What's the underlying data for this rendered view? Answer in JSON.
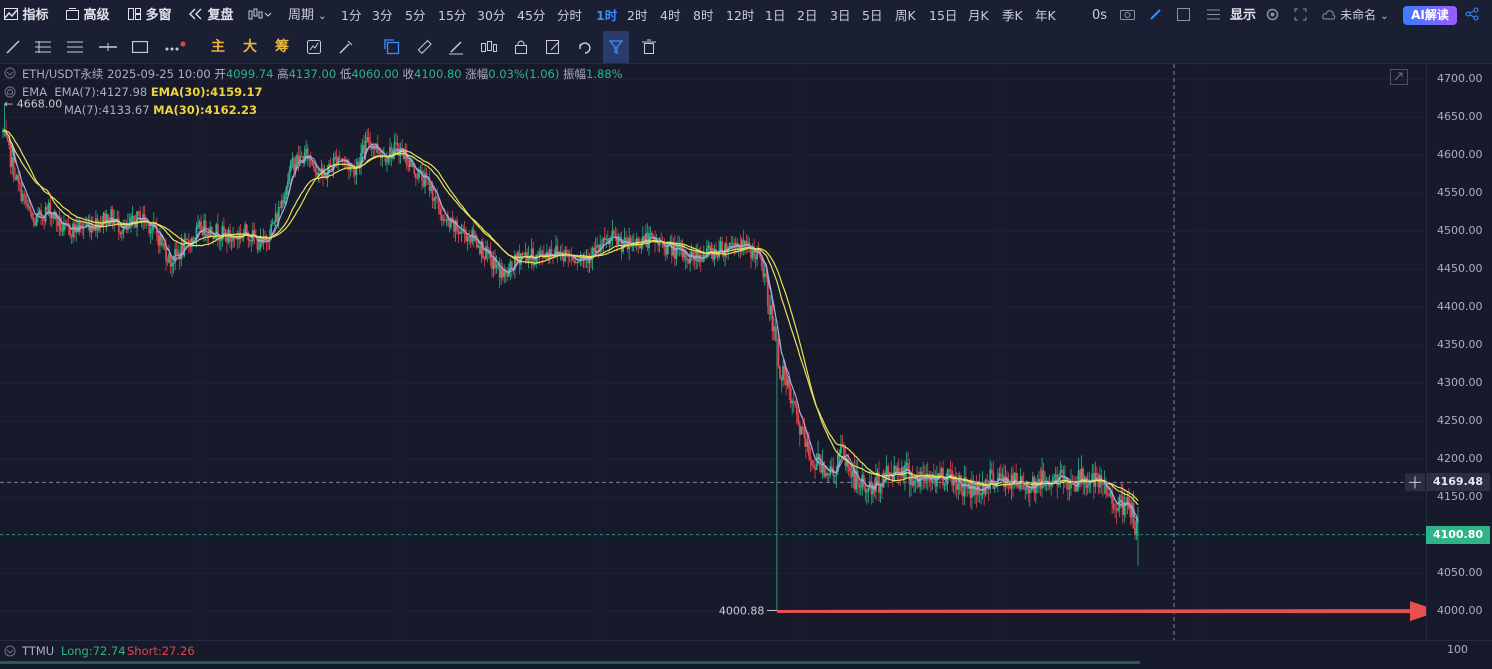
{
  "toolbar": {
    "indicators": "指标",
    "template": "高级",
    "multi_window": "多窗",
    "replay": "复盘",
    "period": "周期",
    "timeframes": [
      "1分",
      "3分",
      "5分",
      "15分",
      "30分",
      "45分",
      "分时",
      "1时",
      "2时",
      "4时",
      "8时",
      "12时",
      "1日",
      "2日",
      "3日",
      "5日",
      "周K",
      "15日",
      "月K",
      "季K",
      "年K"
    ],
    "active_timeframe": "1时",
    "latency": "0s",
    "display": "显示",
    "layout_name": "未命名",
    "ai_label": "AI解读"
  },
  "drawing_tools": {
    "main_label": "主",
    "big_label": "大",
    "chip_label": "筹"
  },
  "legend": {
    "symbol": "ETH/USDT永续",
    "datetime": "2025-09-25 10:00",
    "open_label": "开",
    "open": "4099.74",
    "high_label": "高",
    "high": "4137.00",
    "low_label": "低",
    "low": "4060.00",
    "close_label": "收",
    "close": "4100.80",
    "change_label": "涨幅",
    "change": "0.03%(1.06)",
    "amp_label": "振幅",
    "amp": "1.88%",
    "ema_name": "EMA",
    "ema7": "EMA(7):4127.98",
    "ema30": "EMA(30):4159.17",
    "ma7": "MA(7):4133.67",
    "ma30": "MA(30):4162.23"
  },
  "markers": {
    "high_mark": "4668.00",
    "low_mark": "4000.88",
    "crosshair_price": "4169.48",
    "last_price": "4100.80"
  },
  "colors": {
    "up": "#2fb48a",
    "down": "#e0464e",
    "ma_yellow": "#e7e05a",
    "ema_gray": "#a4a8d6",
    "arrow": "#e8504f",
    "last_tag": "#2fb48a"
  },
  "ttmu": {
    "name": "TTMU",
    "long": "Long:72.74",
    "short": "Short:27.26",
    "axis_value": "100"
  },
  "chart_data": {
    "type": "candlestick",
    "y_ticks": [
      4700,
      4650,
      4600,
      4550,
      4500,
      4450,
      4400,
      4350,
      4300,
      4250,
      4200,
      4150,
      4100,
      4050,
      4000
    ],
    "ylim": [
      3962,
      4720
    ],
    "anchors_close": [
      [
        0,
        4630
      ],
      [
        10,
        4560
      ],
      [
        20,
        4510
      ],
      [
        30,
        4530
      ],
      [
        40,
        4500
      ],
      [
        50,
        4505
      ],
      [
        60,
        4510
      ],
      [
        70,
        4520
      ],
      [
        80,
        4500
      ],
      [
        90,
        4520
      ],
      [
        100,
        4500
      ],
      [
        110,
        4460
      ],
      [
        120,
        4480
      ],
      [
        130,
        4505
      ],
      [
        140,
        4500
      ],
      [
        150,
        4490
      ],
      [
        160,
        4500
      ],
      [
        170,
        4480
      ],
      [
        180,
        4520
      ],
      [
        190,
        4590
      ],
      [
        200,
        4600
      ],
      [
        210,
        4570
      ],
      [
        220,
        4600
      ],
      [
        230,
        4580
      ],
      [
        240,
        4620
      ],
      [
        250,
        4600
      ],
      [
        260,
        4610
      ],
      [
        270,
        4580
      ],
      [
        280,
        4560
      ],
      [
        290,
        4510
      ],
      [
        300,
        4500
      ],
      [
        310,
        4490
      ],
      [
        320,
        4460
      ],
      [
        330,
        4440
      ],
      [
        340,
        4470
      ],
      [
        350,
        4465
      ],
      [
        360,
        4475
      ],
      [
        370,
        4470
      ],
      [
        380,
        4465
      ],
      [
        390,
        4475
      ],
      [
        400,
        4490
      ],
      [
        410,
        4480
      ],
      [
        420,
        4490
      ],
      [
        430,
        4485
      ],
      [
        440,
        4475
      ],
      [
        450,
        4465
      ],
      [
        460,
        4470
      ],
      [
        470,
        4475
      ],
      [
        480,
        4485
      ],
      [
        490,
        4475
      ],
      [
        495,
        4470
      ],
      [
        500,
        4440
      ],
      [
        510,
        4320
      ],
      [
        520,
        4260
      ],
      [
        530,
        4200
      ],
      [
        540,
        4190
      ],
      [
        545,
        4180
      ],
      [
        550,
        4210
      ],
      [
        560,
        4170
      ],
      [
        570,
        4160
      ],
      [
        580,
        4180
      ],
      [
        590,
        4190
      ],
      [
        600,
        4170
      ],
      [
        610,
        4175
      ],
      [
        620,
        4180
      ],
      [
        630,
        4165
      ],
      [
        640,
        4160
      ],
      [
        650,
        4175
      ],
      [
        660,
        4170
      ],
      [
        670,
        4165
      ],
      [
        680,
        4170
      ],
      [
        690,
        4175
      ],
      [
        700,
        4170
      ],
      [
        710,
        4175
      ],
      [
        720,
        4165
      ],
      [
        730,
        4145
      ],
      [
        735,
        4135
      ],
      [
        740,
        4135
      ],
      [
        745,
        4100
      ]
    ]
  }
}
